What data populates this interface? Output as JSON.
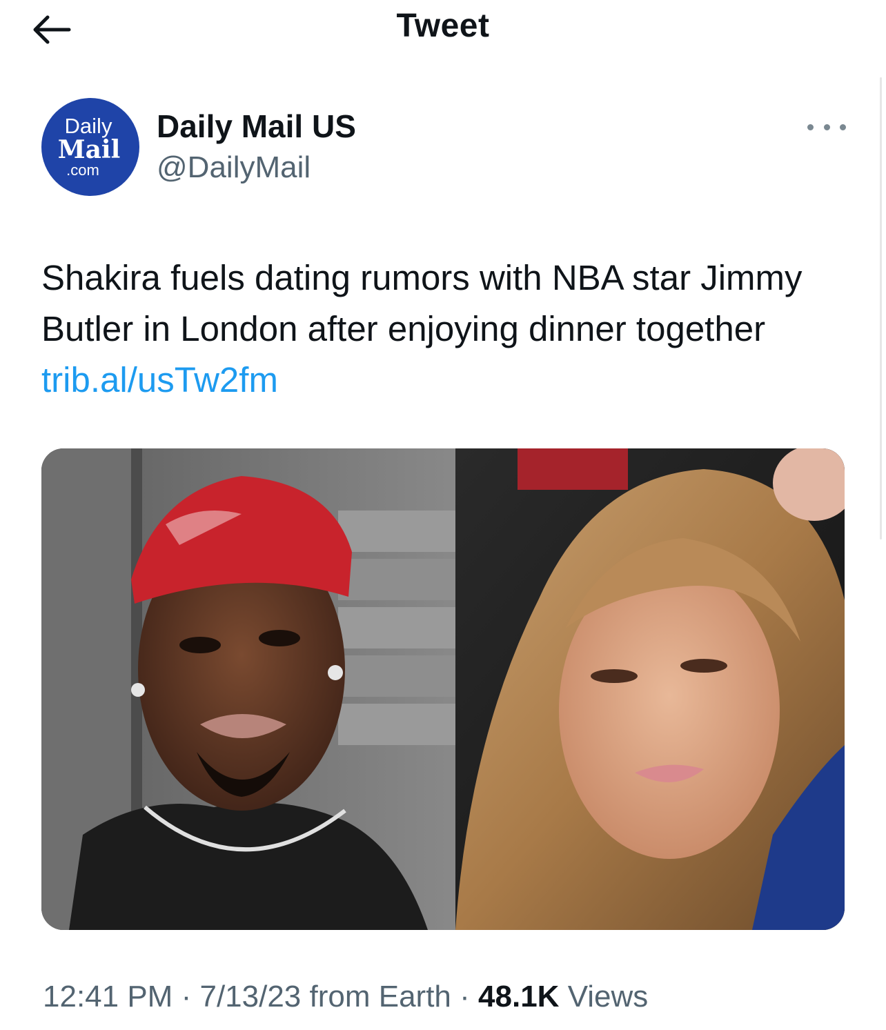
{
  "header": {
    "title": "Tweet",
    "back_icon": "arrow-left-icon"
  },
  "author": {
    "display_name": "Daily Mail US",
    "handle": "@DailyMail",
    "avatar_lines": [
      "Daily",
      "Mail",
      ".com"
    ],
    "avatar_color": "#1f44a8",
    "more_icon": "more-dots-icon"
  },
  "tweet": {
    "text": "Shakira fuels dating rumors with NBA star Jimmy Butler in London after enjoying dinner together",
    "link": "trib.al/usTw2fm",
    "link_color": "#1d9bf0"
  },
  "meta": {
    "time": "12:41 PM",
    "separator": "·",
    "date": "7/13/23",
    "source": "from Earth",
    "views_count": "48.1K",
    "views_label": "Views"
  }
}
